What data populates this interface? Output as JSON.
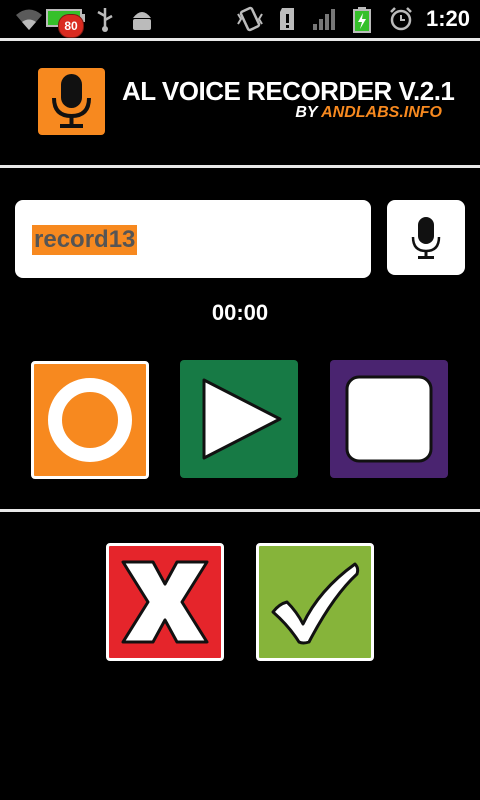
{
  "status_bar": {
    "time": "1:20",
    "notification_badge": "80",
    "icons": [
      "wifi-icon",
      "battery-charging-icon",
      "usb-icon",
      "android-debug-icon",
      "vibrate-icon",
      "sd-card-icon",
      "signal-icon",
      "battery-icon",
      "alarm-icon"
    ]
  },
  "header": {
    "title": "AL VOICE RECORDER V.2.1",
    "by_label": "BY",
    "brand": "ANDLABS.INFO",
    "logo_icon": "microphone-icon"
  },
  "recorder": {
    "file_name": "record13",
    "timer": "00:00",
    "voice_input_icon": "microphone-icon"
  },
  "controls": {
    "record_icon": "record-icon",
    "play_icon": "play-icon",
    "stop_icon": "stop-icon",
    "cancel_icon": "cancel-x-icon",
    "confirm_icon": "checkmark-icon"
  },
  "colors": {
    "accent_orange": "#f7891f",
    "play_green": "#177a45",
    "stop_purple": "#4a2470",
    "cancel_red": "#e5252b",
    "confirm_green": "#86b43a"
  }
}
